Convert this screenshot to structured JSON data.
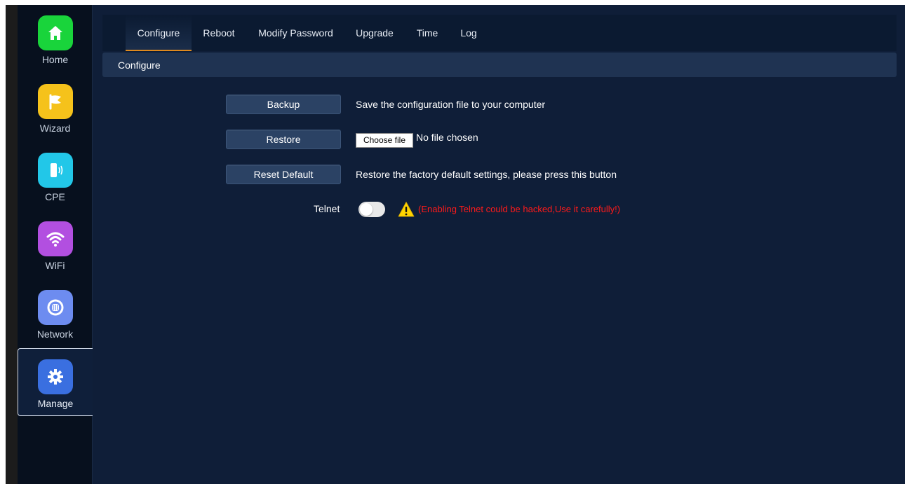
{
  "sidebar": {
    "items": [
      {
        "label": "Home",
        "icon": "home-icon",
        "color": "#19d43b"
      },
      {
        "label": "Wizard",
        "icon": "flag-icon",
        "color": "#f5c21b"
      },
      {
        "label": "CPE",
        "icon": "cpe-device-icon",
        "color": "#22c7e8"
      },
      {
        "label": "WiFi",
        "icon": "wifi-icon",
        "color": "#b24fe0"
      },
      {
        "label": "Network",
        "icon": "network-icon",
        "color": "#6d8cf0"
      },
      {
        "label": "Manage",
        "icon": "gear-icon",
        "color": "#3a6fe0"
      }
    ],
    "active": "Manage"
  },
  "tabs": [
    "Configure",
    "Reboot",
    "Modify Password",
    "Upgrade",
    "Time",
    "Log"
  ],
  "active_tab": "Configure",
  "section_title": "Configure",
  "actions": {
    "backup": {
      "label": "Backup",
      "description": "Save the configuration file to your computer"
    },
    "restore": {
      "label": "Restore",
      "file_button": "Choose file",
      "file_status": "No file chosen"
    },
    "reset": {
      "label": "Reset Default",
      "description": "Restore the factory default settings, please press this button"
    }
  },
  "telnet": {
    "label": "Telnet",
    "enabled": false,
    "warning": "(Enabling Telnet could be hacked,Use it carefully!)",
    "warning_color": "#ff1a1a"
  }
}
